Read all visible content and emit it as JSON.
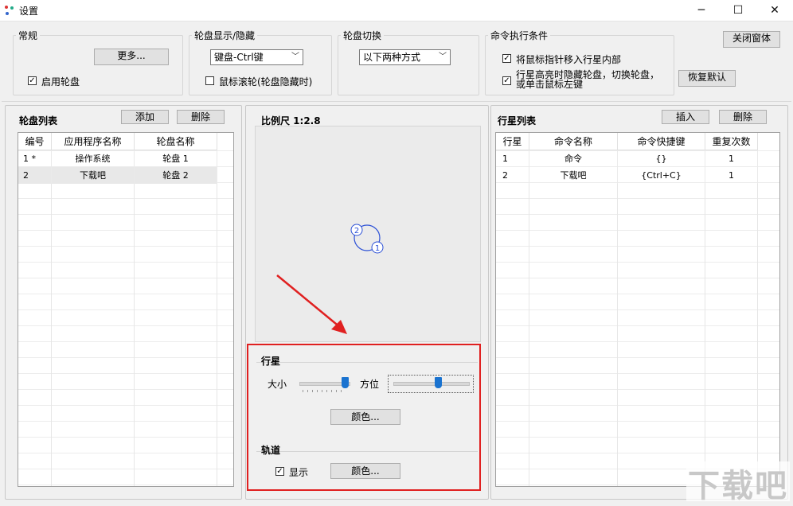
{
  "window": {
    "title": "设置",
    "minimize": "─",
    "maximize": "☐",
    "close": "✕"
  },
  "general": {
    "label": "常规",
    "more_button": "更多...",
    "enable_wheel": "启用轮盘",
    "enable_checked": true
  },
  "show_hide": {
    "label": "轮盘显示/隐藏",
    "select_value": "键盘-Ctrl键",
    "mouse_scroll": "鼠标滚轮(轮盘隐藏时)",
    "mouse_checked": false
  },
  "switch": {
    "label": "轮盘切换",
    "select_value": "以下两种方式"
  },
  "exec": {
    "label": "命令执行条件",
    "opt1": "将鼠标指针移入行星内部",
    "opt1_checked": true,
    "opt2_line1": "行星高亮时隐藏轮盘，切换轮盘，",
    "opt2_line2": "或单击鼠标左键",
    "opt2_checked": true
  },
  "close_window_button": "关闭窗体",
  "restore_default_button": "恢复默认",
  "wheel_list": {
    "title": "轮盘列表",
    "add_button": "添加",
    "delete_button": "删除",
    "headers": [
      "编号",
      "应用程序名称",
      "轮盘名称"
    ],
    "rows": [
      [
        "1 *",
        "操作系统",
        "轮盘 1"
      ],
      [
        "2",
        "下载吧",
        "轮盘 2"
      ]
    ]
  },
  "preview": {
    "scale_label": "比例尺 1:2.8",
    "planet1": "1",
    "planet2": "2"
  },
  "planet": {
    "label": "行星",
    "size_label": "大小",
    "size_value": 0.95,
    "direction_label": "方位",
    "direction_value": 0.6,
    "color_button": "颜色..."
  },
  "orbit": {
    "label": "轨道",
    "show_label": "显示",
    "show_checked": true,
    "color_button": "颜色..."
  },
  "star_list": {
    "title": "行星列表",
    "insert_button": "插入",
    "delete_button": "删除",
    "headers": [
      "行星",
      "命令名称",
      "命令快捷键",
      "重复次数"
    ],
    "rows": [
      [
        "1",
        "命令",
        "{}",
        "1"
      ],
      [
        "2",
        "下载吧",
        "{Ctrl+C}",
        "1"
      ]
    ]
  },
  "watermark": "下载吧",
  "colors": {
    "highlight_box": "#e02020",
    "arrow": "#e02020",
    "slider_thumb": "#1a73d0",
    "planet_stroke": "#2a4fd6"
  }
}
